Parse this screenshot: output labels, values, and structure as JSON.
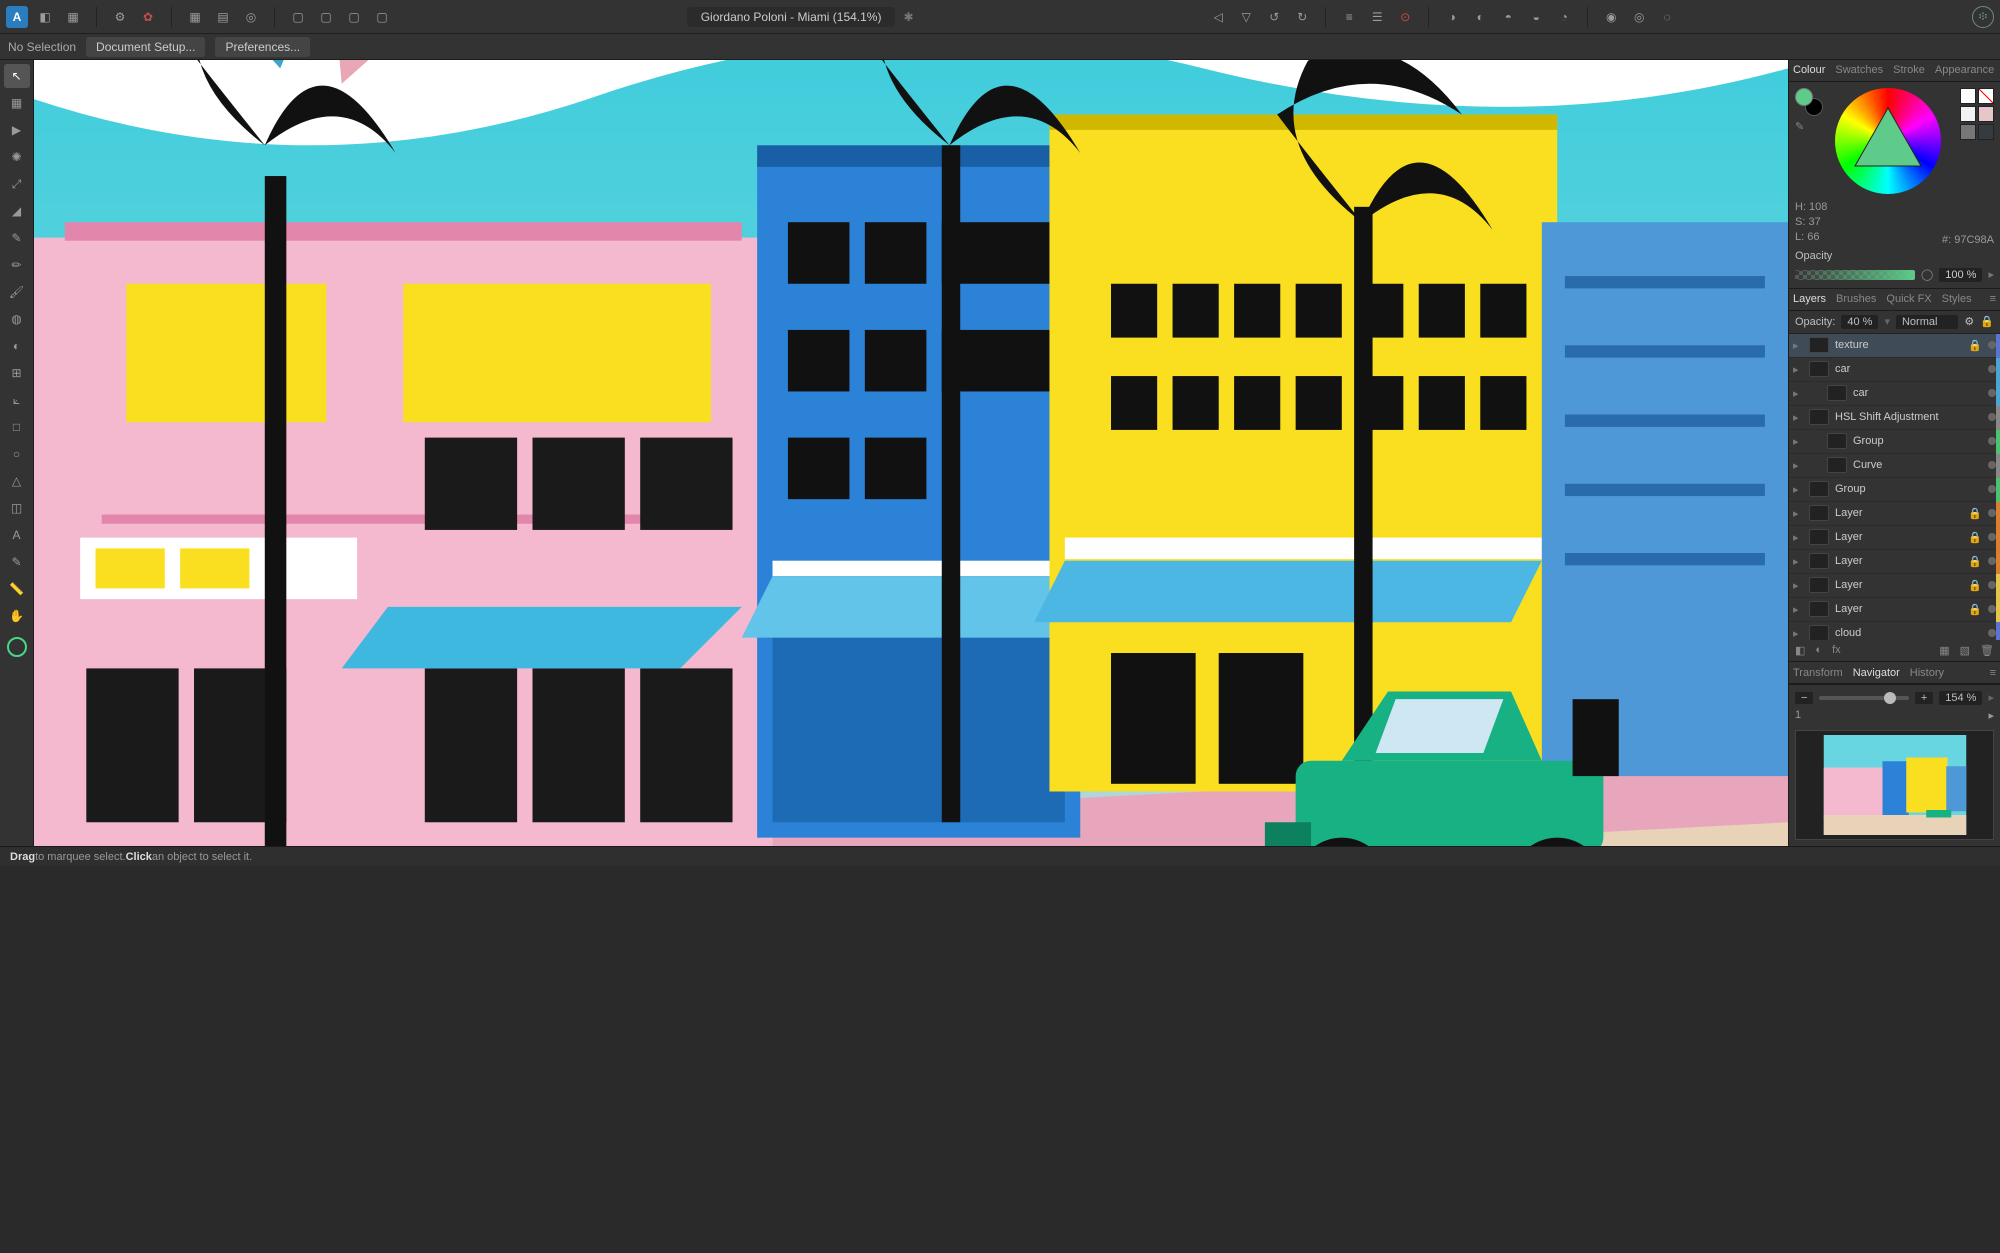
{
  "app": {
    "title": "Giordano Poloni - Miami (154.1%)"
  },
  "contextbar": {
    "selection": "No Selection",
    "doc_setup": "Document Setup...",
    "prefs": "Preferences..."
  },
  "tools": [
    {
      "name": "move-tool",
      "glyph": "↖",
      "active": true
    },
    {
      "name": "selection-tool",
      "glyph": "▦"
    },
    {
      "name": "node-tool",
      "glyph": "▶"
    },
    {
      "name": "point-transform-tool",
      "glyph": "✺"
    },
    {
      "name": "contour-tool",
      "glyph": "⤢"
    },
    {
      "name": "corner-tool",
      "glyph": "◢"
    },
    {
      "name": "pen-tool",
      "glyph": "✎"
    },
    {
      "name": "pencil-tool",
      "glyph": "✏"
    },
    {
      "name": "brush-tool",
      "glyph": "🖌"
    },
    {
      "name": "fill-tool",
      "glyph": "◍"
    },
    {
      "name": "transparency-tool",
      "glyph": "◐"
    },
    {
      "name": "place-tool",
      "glyph": "⊞"
    },
    {
      "name": "crop-tool",
      "glyph": "⟀"
    },
    {
      "name": "rectangle-tool",
      "glyph": "□"
    },
    {
      "name": "ellipse-tool",
      "glyph": "○"
    },
    {
      "name": "triangle-tool",
      "glyph": "△"
    },
    {
      "name": "artboard-tool",
      "glyph": "◫"
    },
    {
      "name": "text-tool",
      "glyph": "A"
    },
    {
      "name": "eyedropper-tool",
      "glyph": "✎"
    },
    {
      "name": "measure-tool",
      "glyph": "📏"
    },
    {
      "name": "hand-tool",
      "glyph": "✋"
    }
  ],
  "colour": {
    "tabs": [
      "Colour",
      "Swatches",
      "Stroke",
      "Appearance"
    ],
    "active_tab": "Colour",
    "fill": "#5ecb8a",
    "stroke": "#000000",
    "h": 108,
    "s": 37,
    "l": 66,
    "h_label": "H: 108",
    "s_label": "S: 37",
    "l_label": "L: 66",
    "hex_label": "#:",
    "hex": "97C98A",
    "opacity_label": "Opacity",
    "opacity_val": "100 %",
    "swatches": [
      "#ffffff",
      "none",
      "#f2f2f2",
      "#e6c6c8",
      "#777777",
      "#353b3f"
    ]
  },
  "layers": {
    "tabs": [
      "Layers",
      "Brushes",
      "Quick FX",
      "Styles"
    ],
    "active_tab": "Layers",
    "opacity_label": "Opacity:",
    "opacity_val": "40 %",
    "blend": "Normal",
    "items": [
      {
        "name": "texture",
        "indent": 1,
        "tag": "#5b74d1",
        "selected": true,
        "lock": true
      },
      {
        "name": "car",
        "indent": 1,
        "tag": "#4aa4d6"
      },
      {
        "name": "car",
        "indent": 2,
        "tag": "#4aa4d6"
      },
      {
        "name": "HSL Shift Adjustment",
        "indent": 1,
        "tag": "#888"
      },
      {
        "name": "Group",
        "indent": 2,
        "tag": "#4cc36f"
      },
      {
        "name": "Curve",
        "indent": 2,
        "tag": "#888"
      },
      {
        "name": "Group",
        "indent": 1,
        "tag": "#4cc36f"
      },
      {
        "name": "Layer",
        "indent": 1,
        "tag": "#d98030",
        "lock": true
      },
      {
        "name": "Layer",
        "indent": 1,
        "tag": "#d98030",
        "lock": true
      },
      {
        "name": "Layer",
        "indent": 1,
        "tag": "#d98030",
        "lock": true
      },
      {
        "name": "Layer",
        "indent": 1,
        "tag": "#e2c54a",
        "lock": true
      },
      {
        "name": "Layer",
        "indent": 1,
        "tag": "#e2c54a",
        "lock": true
      },
      {
        "name": "cloud",
        "indent": 1,
        "tag": "#5b74d1"
      }
    ]
  },
  "navigator": {
    "tabs": [
      "Transform",
      "Navigator",
      "History"
    ],
    "active_tab": "Navigator",
    "zoom_val": "154 %",
    "page_count": "1"
  },
  "status": {
    "drag": "Drag",
    "drag_text": " to marquee select. ",
    "click": "Click",
    "click_text": " an object to select it."
  }
}
